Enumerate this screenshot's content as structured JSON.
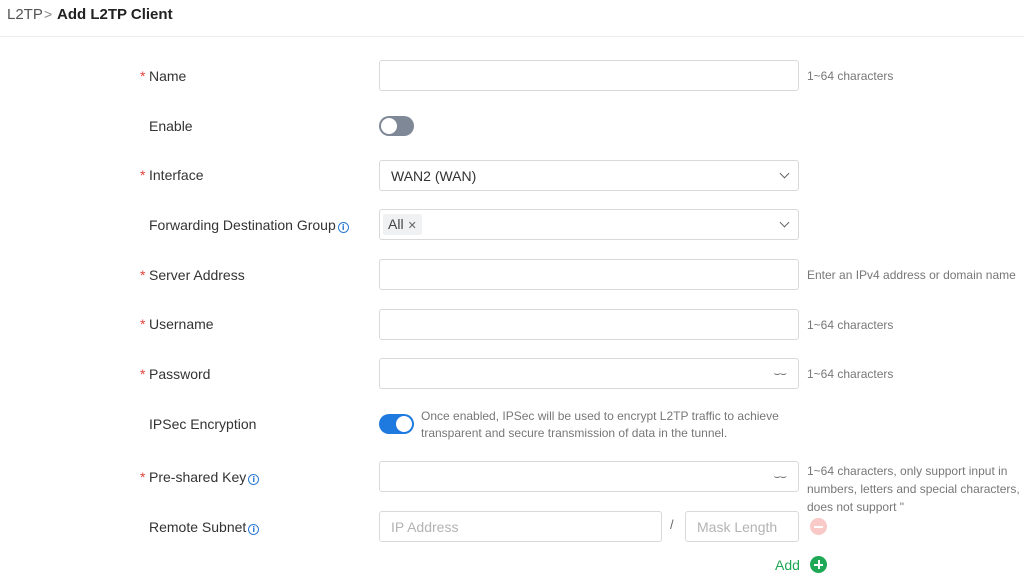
{
  "breadcrumb": {
    "parent": "L2TP",
    "separator": ">",
    "current": "Add L2TP Client"
  },
  "fields": {
    "name": {
      "label": "Name",
      "required": "*",
      "value": "",
      "hint": "1~64 characters"
    },
    "enable": {
      "label": "Enable",
      "state": "off"
    },
    "interface": {
      "label": "Interface",
      "required": "*",
      "value": "WAN2 (WAN)"
    },
    "forwarding_group": {
      "label": "Forwarding Destination Group",
      "tag": "All",
      "tag_remove": "✕"
    },
    "server_address": {
      "label": "Server Address",
      "required": "*",
      "value": "",
      "hint": "Enter an IPv4 address or domain name"
    },
    "username": {
      "label": "Username",
      "required": "*",
      "value": "",
      "hint": "1~64 characters"
    },
    "password": {
      "label": "Password",
      "required": "*",
      "value": "",
      "hint": "1~64 characters"
    },
    "ipsec": {
      "label": "IPSec Encryption",
      "state": "on",
      "description": "Once enabled, IPSec will be used to encrypt L2TP traffic to achieve transparent and secure transmission of data in the tunnel."
    },
    "psk": {
      "label": "Pre-shared Key",
      "required": "*",
      "value": "",
      "hint": "1~64 characters, only support input in numbers, letters and special characters, does not support \""
    },
    "remote_subnet": {
      "label": "Remote Subnet",
      "ip_placeholder": "IP Address",
      "separator": "/",
      "mask_placeholder": "Mask Length"
    }
  },
  "actions": {
    "add_label": "Add"
  },
  "icons": {
    "info": "i",
    "eye": "⌣⌣"
  },
  "colors": {
    "required": "#e0453a",
    "toggle_on": "#1f7ae0",
    "toggle_off": "#7f8896",
    "add": "#1fa855",
    "remove": "#f8c9c6",
    "info": "#2a78d4"
  }
}
